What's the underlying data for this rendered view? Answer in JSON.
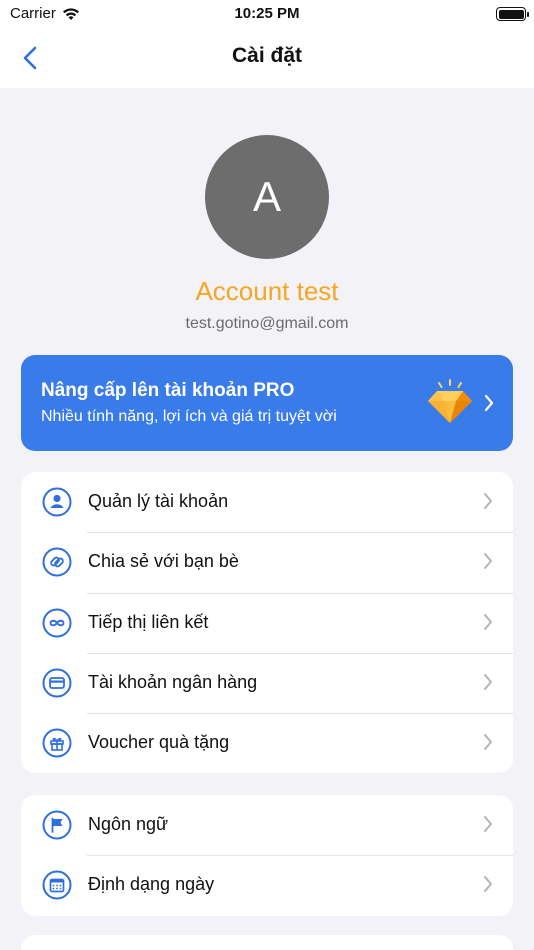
{
  "status_bar": {
    "carrier": "Carrier",
    "time": "10:25 PM",
    "icons": [
      "wifi-icon",
      "battery-icon"
    ]
  },
  "nav": {
    "title": "Cài đặt",
    "back_icon": "chevron-left-icon"
  },
  "profile": {
    "avatar_initial": "A",
    "name": "Account test",
    "email": "test.gotino@gmail.com",
    "name_color": "#f5a623"
  },
  "pro_banner": {
    "title": "Nâng cấp lên tài khoản PRO",
    "subtitle": "Nhiều tính năng, lợi ích và giá trị tuyệt vời",
    "icon": "diamond-icon",
    "background_color": "#3a7bea"
  },
  "account_section": {
    "items": [
      {
        "label": "Quản lý tài khoản",
        "icon": "user-icon"
      },
      {
        "label": "Chia sẻ với bạn bè",
        "icon": "link-icon"
      },
      {
        "label": "Tiếp thị liên kết",
        "icon": "infinity-icon"
      },
      {
        "label": "Tài khoản ngân hàng",
        "icon": "credit-card-icon"
      },
      {
        "label": "Voucher quà tặng",
        "icon": "gift-icon"
      }
    ]
  },
  "preferences_section": {
    "items": [
      {
        "label": "Ngôn ngữ",
        "icon": "flag-icon"
      },
      {
        "label": "Định dạng ngày",
        "icon": "calendar-icon"
      }
    ]
  },
  "colors": {
    "accent": "#2f6fde",
    "background": "#f2f2f7"
  }
}
